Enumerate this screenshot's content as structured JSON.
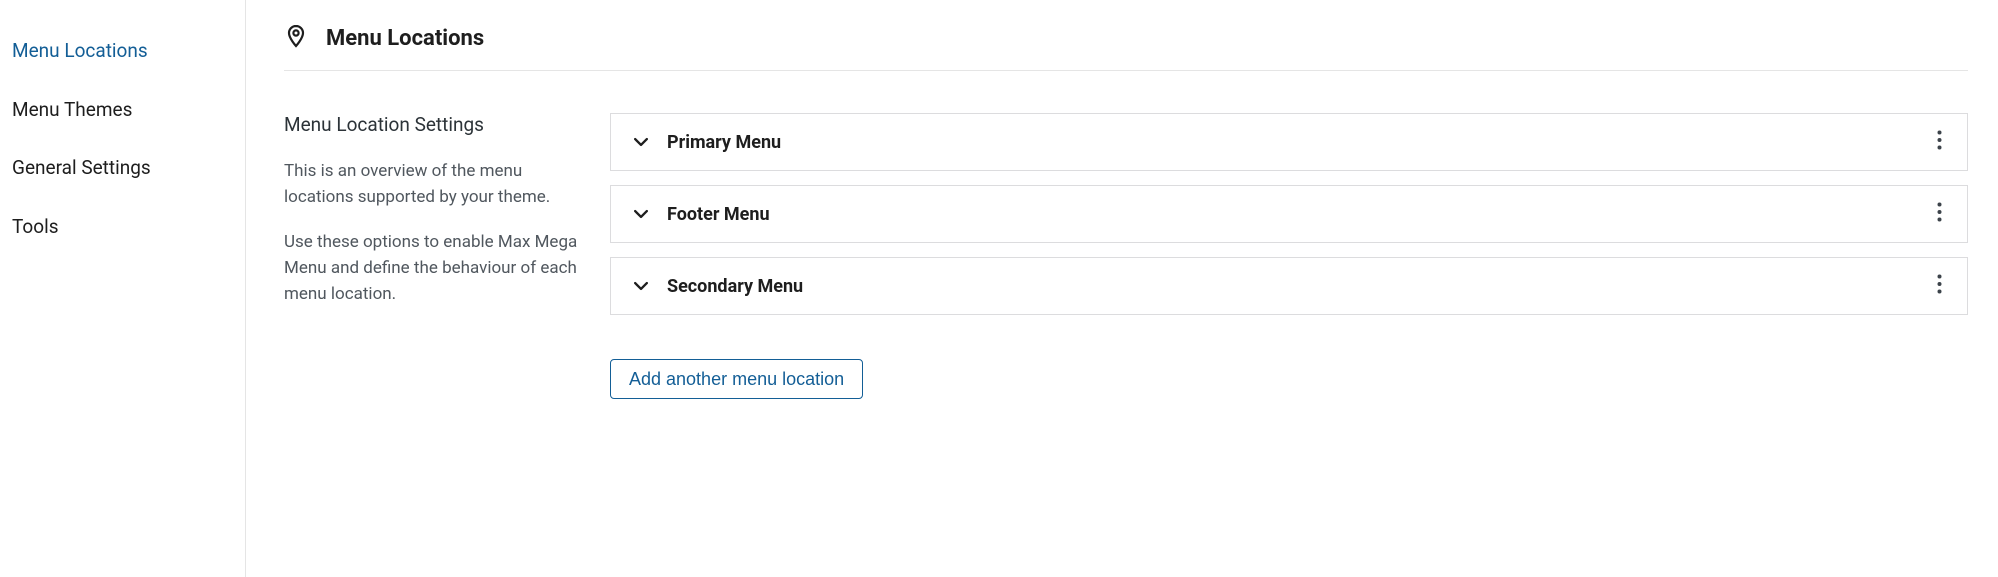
{
  "sidebar": {
    "items": [
      {
        "label": "Menu Locations",
        "active": true
      },
      {
        "label": "Menu Themes",
        "active": false
      },
      {
        "label": "General Settings",
        "active": false
      },
      {
        "label": "Tools",
        "active": false
      }
    ]
  },
  "header": {
    "title": "Menu Locations"
  },
  "settings": {
    "title": "Menu Location Settings",
    "desc1": "This is an overview of the menu locations supported by your theme.",
    "desc2": "Use these options to enable Max Mega Menu and define the behaviour of each menu location."
  },
  "locations": [
    {
      "label": "Primary Menu"
    },
    {
      "label": "Footer Menu"
    },
    {
      "label": "Secondary Menu"
    }
  ],
  "buttons": {
    "add": "Add another menu location"
  }
}
